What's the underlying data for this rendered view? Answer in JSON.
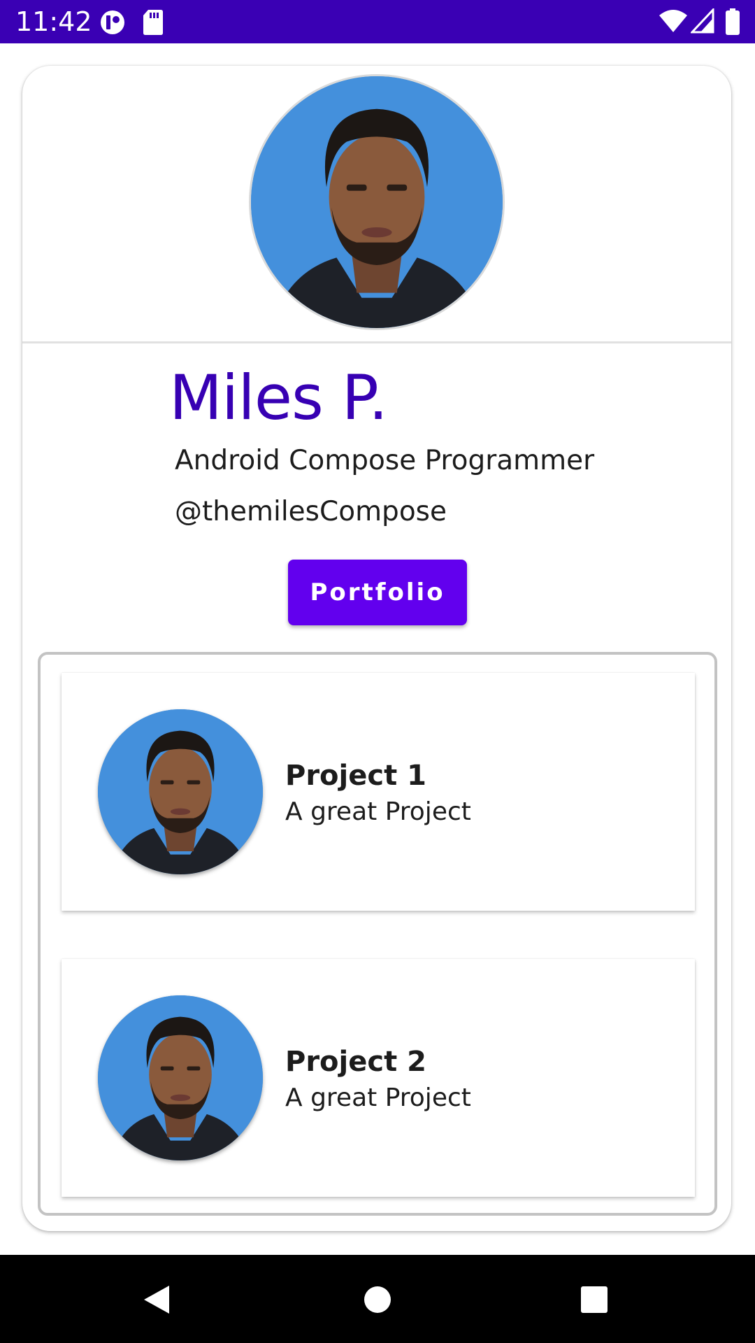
{
  "status_bar": {
    "time": "11:42",
    "left_icons": [
      "vpn-key-icon",
      "sd-card-icon"
    ],
    "right_icons": [
      "wifi-icon",
      "cell-signal-icon",
      "battery-icon"
    ],
    "background": "#3a00b4"
  },
  "profile": {
    "avatar": "profile-photo",
    "name": "Miles P.",
    "role": "Android Compose Programmer",
    "handle": "@themilesCompose",
    "button_label": "Portfolio",
    "accent_color": "#6200ee",
    "name_color": "#3700b3"
  },
  "projects": [
    {
      "title": "Project 1",
      "description": "A great Project",
      "avatar": "project-photo"
    },
    {
      "title": "Project 2",
      "description": "A great Project",
      "avatar": "project-photo"
    }
  ],
  "nav_bar": {
    "buttons": [
      "back-icon",
      "home-icon",
      "recents-icon"
    ]
  }
}
